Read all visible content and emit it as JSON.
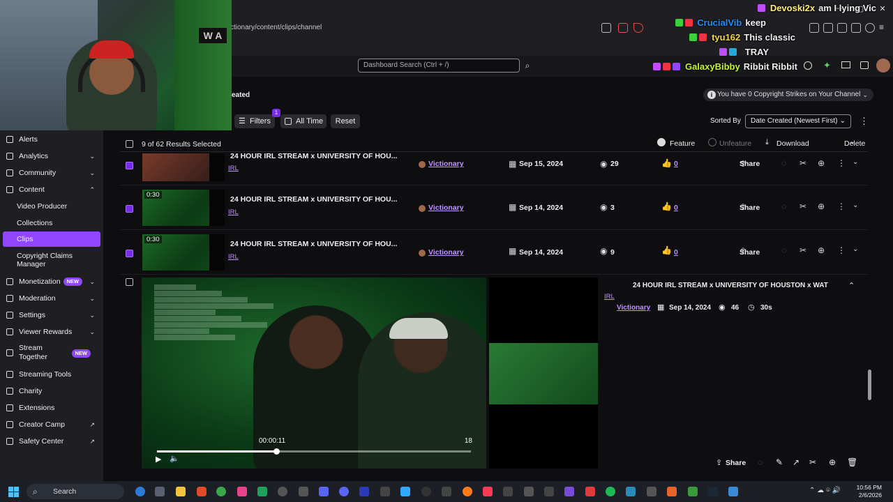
{
  "browser": {
    "url": "ctionary/content/clips/channel",
    "window_controls": [
      "—",
      "▢",
      "✕"
    ]
  },
  "topbar": {
    "search_placeholder": "Dashboard Search (Ctrl + /)"
  },
  "chat_overlay": [
    {
      "user": "Devoski2x",
      "msg": "am I lying Vic",
      "color": "#ffef6e"
    },
    {
      "user": "CrucialVib",
      "msg": "keep",
      "color": "#1e90ff"
    },
    {
      "user": "tyu162",
      "msg": "This classic",
      "color": "#f5d742"
    },
    {
      "user": "",
      "msg": "TRAY",
      "color": "#ff2d2d"
    },
    {
      "user": "GalaxyBibby",
      "msg": "Ribbit Ribbit",
      "color": "#c7f531"
    }
  ],
  "header": {
    "partial_title": "eated",
    "strikes_notice": "You have 0 Copyright Strikes on Your Channel"
  },
  "toolbar": {
    "filters_label": "Filters",
    "filters_count": "1",
    "alltime_label": "All Time",
    "reset_label": "Reset",
    "sorted_by_label": "Sorted By",
    "sort_value": "Date Created (Newest First)"
  },
  "selection": {
    "summary": "9 of 62 Results Selected",
    "feature_label": "Feature",
    "unfeature_label": "Unfeature",
    "download_label": "Download",
    "delete_label": "Delete"
  },
  "sidebar": {
    "items": [
      {
        "label": "Alerts",
        "chevron": ""
      },
      {
        "label": "Analytics",
        "chevron": "⌄"
      },
      {
        "label": "Community",
        "chevron": "⌄"
      },
      {
        "label": "Content",
        "chevron": "⌃"
      },
      {
        "label": "Video Producer",
        "chevron": ""
      },
      {
        "label": "Collections",
        "chevron": ""
      },
      {
        "label": "Clips",
        "chevron": ""
      },
      {
        "label": "Copyright Claims Manager",
        "chevron": ""
      },
      {
        "label": "Monetization",
        "chevron": "⌄",
        "badge": "NEW"
      },
      {
        "label": "Moderation",
        "chevron": "⌄"
      },
      {
        "label": "Settings",
        "chevron": "⌄"
      },
      {
        "label": "Viewer Rewards",
        "chevron": "⌄"
      },
      {
        "label": "Stream Together",
        "chevron": "",
        "badge": "NEW"
      },
      {
        "label": "Streaming Tools",
        "chevron": ""
      },
      {
        "label": "Charity",
        "chevron": ""
      },
      {
        "label": "Extensions",
        "chevron": ""
      },
      {
        "label": "Creator Camp",
        "chevron": "↗"
      },
      {
        "label": "Safety Center",
        "chevron": "↗"
      }
    ]
  },
  "clips": [
    {
      "duration": "",
      "title": "24 HOUR IRL STREAM x UNIVERSITY OF HOU...",
      "tag": "IRL",
      "channel": "Victionary",
      "date": "Sep 15, 2024",
      "views": "29",
      "likes": "0",
      "share": "Share"
    },
    {
      "duration": "0:30",
      "title": "24 HOUR IRL STREAM x UNIVERSITY OF HOU...",
      "tag": "IRL",
      "channel": "Victionary",
      "date": "Sep 14, 2024",
      "views": "3",
      "likes": "0",
      "share": "Share"
    },
    {
      "duration": "0:30",
      "title": "24 HOUR IRL STREAM x UNIVERSITY OF HOU...",
      "tag": "IRL",
      "channel": "Victionary",
      "date": "Sep 14, 2024",
      "views": "9",
      "likes": "0",
      "share": "Share"
    }
  ],
  "expanded": {
    "title": "24 HOUR IRL STREAM x UNIVERSITY OF HOUSTON x WAT",
    "tag": "IRL",
    "channel": "Victionary",
    "date": "Sep 14, 2024",
    "views": "46",
    "duration": "30s",
    "current_time": "00:00:11",
    "end_label": "18",
    "progress": 0.38,
    "share_label": "Share"
  },
  "taskbar": {
    "search_label": "Search",
    "time": "10:56 PM",
    "date": "2/6/2026"
  }
}
